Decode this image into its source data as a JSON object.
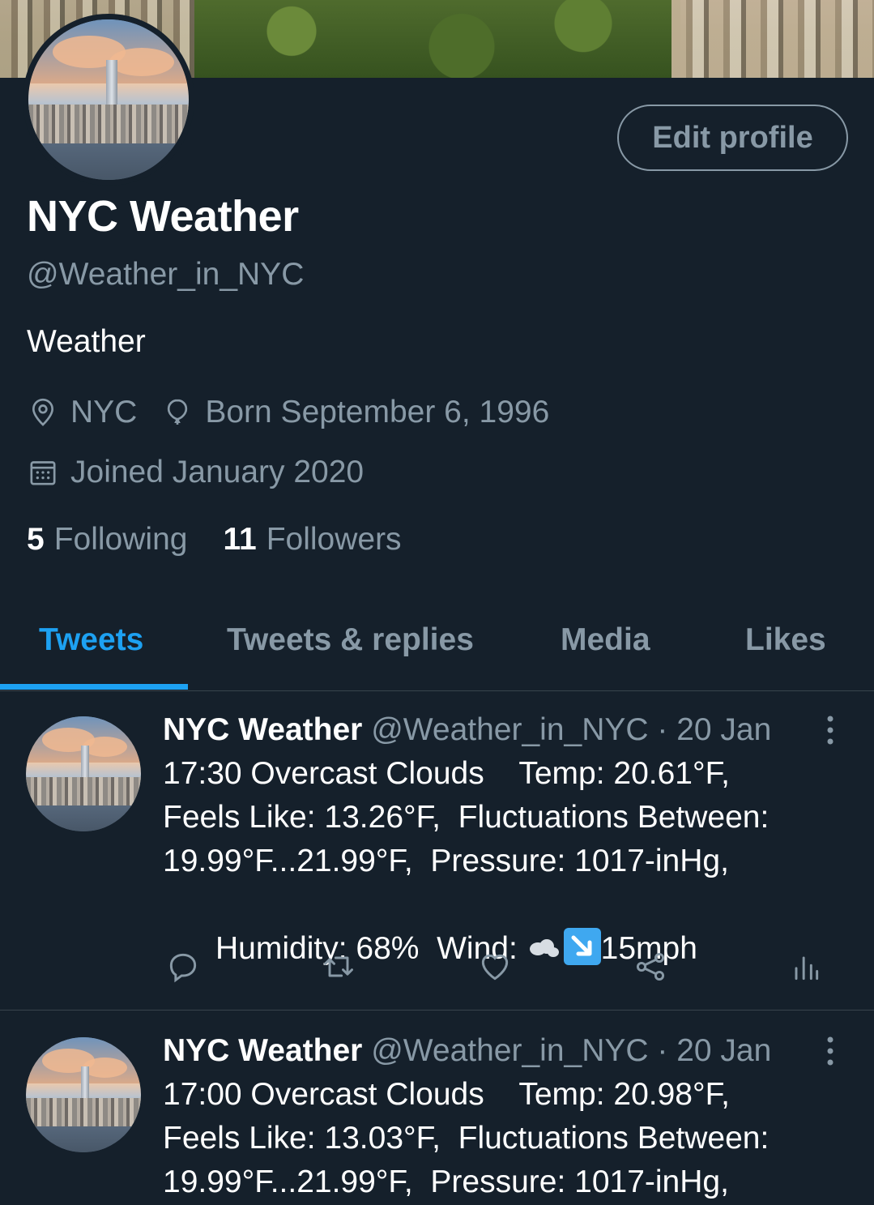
{
  "profile": {
    "name": "NYC Weather",
    "handle": "@Weather_in_NYC",
    "bio": "Weather",
    "location": "NYC",
    "birthday": "Born September 6, 1996",
    "joined": "Joined January 2020",
    "following_count": "5",
    "following_label": "Following",
    "followers_count": "11",
    "followers_label": "Followers",
    "edit_button": "Edit profile"
  },
  "tabs": [
    {
      "label": "Tweets",
      "active": true
    },
    {
      "label": "Tweets & replies",
      "active": false
    },
    {
      "label": "Media",
      "active": false
    },
    {
      "label": "Likes",
      "active": false
    }
  ],
  "tweets": [
    {
      "name": "NYC Weather",
      "handle_time": "@Weather_in_NYC · 20 Jan",
      "line1": "17:30 Overcast Clouds    Temp: 20.61°F,",
      "line2": "Feels Like: 13.26°F,  Fluctuations Between:",
      "line3": "19.99°F...21.99°F,  Pressure: 1017-inHg,",
      "line4a": "Humidity: 68%  Wind: ",
      "line4b": "15mph"
    },
    {
      "name": "NYC Weather",
      "handle_time": "@Weather_in_NYC · 20 Jan",
      "line1": "17:00 Overcast Clouds    Temp: 20.98°F,",
      "line2": "Feels Like: 13.03°F,  Fluctuations Between:",
      "line3": "19.99°F...21.99°F,  Pressure: 1017-inHg,"
    }
  ],
  "colors": {
    "background": "#15202b",
    "accent": "#1da1f2",
    "muted": "#8899a6",
    "divider": "#38444d"
  },
  "icons": [
    "location-icon",
    "balloon-icon",
    "calendar-icon",
    "more-icon",
    "reply-icon",
    "retweet-icon",
    "like-icon",
    "share-icon",
    "analytics-icon"
  ]
}
